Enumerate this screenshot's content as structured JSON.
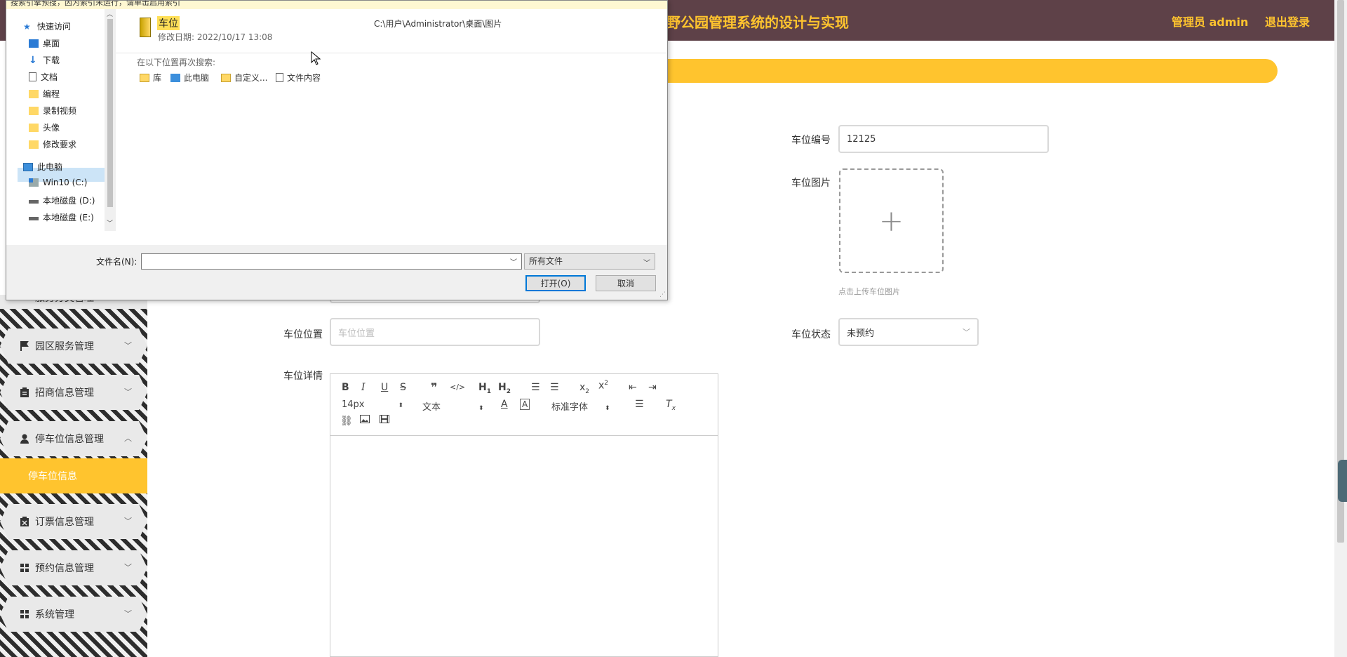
{
  "header": {
    "title": "野公园管理系统的设计与实现",
    "admin_label": "管理员 admin",
    "logout_label": "退出登录",
    "bg_color": "#5e4148",
    "accent_color": "#ffc42e"
  },
  "sidebar": {
    "partial_item": "服务分类管理",
    "items": [
      {
        "label": "园区服务管理",
        "icon": "flag-icon"
      },
      {
        "label": "招商信息管理",
        "icon": "clipboard-icon"
      },
      {
        "label": "停车位信息管理",
        "icon": "user-icon"
      },
      {
        "label": "订票信息管理",
        "icon": "ticket-icon"
      },
      {
        "label": "预约信息管理",
        "icon": "grid-icon"
      },
      {
        "label": "系统管理",
        "icon": "grid-icon"
      }
    ],
    "active_sub_item": "停车位信息"
  },
  "form": {
    "number_label": "车位编号",
    "number_value": "12125",
    "image_label": "车位图片",
    "upload_hint": "点击上传车位图片",
    "location_label": "车位位置",
    "location_placeholder": "车位位置",
    "status_label": "车位状态",
    "status_value": "未预约",
    "detail_label": "车位详情"
  },
  "editor": {
    "font_size": "14px",
    "text_type": "文本",
    "font_family": "标准字体"
  },
  "dialog": {
    "top_strip": "搜索引擎预搜，因为索引未运行，请单击启用索引",
    "nav": {
      "quick_access": "快速访问",
      "desktop": "桌面",
      "downloads": "下载",
      "documents": "文档",
      "programming": "编程",
      "recordings": "录制视频",
      "avatar": "头像",
      "revisions": "修改要求",
      "this_pc": "此电脑",
      "drive_c": "Win10 (C:)",
      "drive_d": "本地磁盘 (D:)",
      "drive_e": "本地磁盘 (E:)"
    },
    "file": {
      "name": "车位",
      "modified": "修改日期: 2022/10/17 13:08",
      "path": "C:\\用户\\Administrator\\桌面\\图片"
    },
    "search_again": "在以下位置再次搜索:",
    "search_links": {
      "library": "库",
      "this_pc": "此电脑",
      "custom": "自定义...",
      "file_content": "文件内容"
    },
    "filename_label": "文件名(N):",
    "filetype": "所有文件",
    "open_label": "打开(O)",
    "cancel_label": "取消"
  }
}
